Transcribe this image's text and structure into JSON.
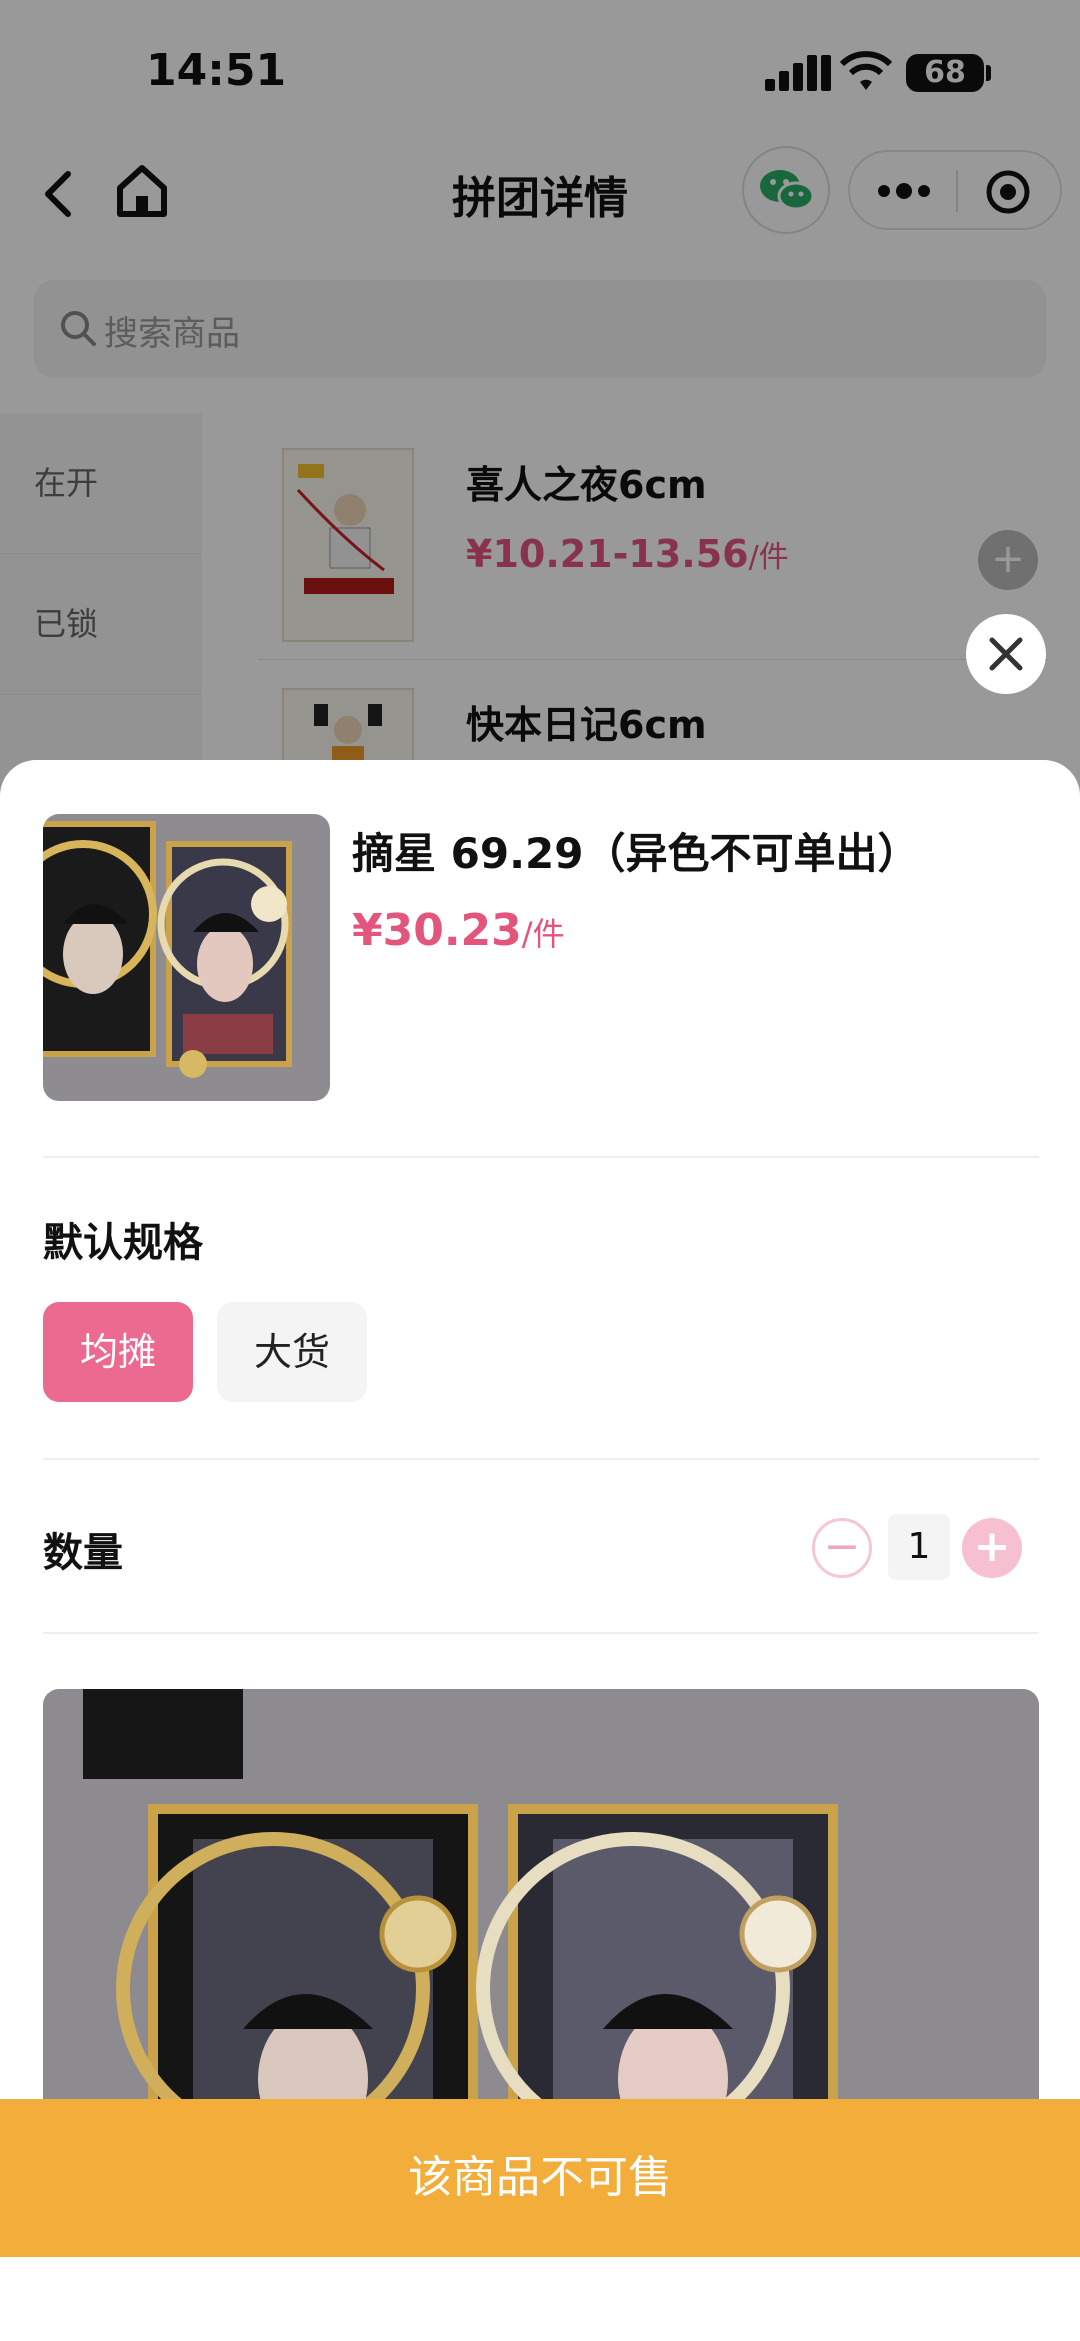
{
  "status_bar": {
    "time": "14:51",
    "battery": "68"
  },
  "nav": {
    "title": "拼团详情"
  },
  "search": {
    "placeholder": "搜索商品"
  },
  "categories": [
    {
      "label": "在开"
    },
    {
      "label": "已锁"
    }
  ],
  "products": [
    {
      "name": "喜人之夜6cm",
      "price": "¥10.21-13.56",
      "unit": "/件"
    },
    {
      "name": "快本日记6cm"
    }
  ],
  "sheet": {
    "title": "摘星 69.29（异色不可单出）",
    "price": "¥30.23",
    "unit": "/件",
    "spec_label": "默认规格",
    "spec_options": [
      {
        "label": "均摊",
        "selected": true
      },
      {
        "label": "大货",
        "selected": false
      }
    ],
    "quantity_label": "数量",
    "quantity_value": "1",
    "buy_button": "该商品不可售"
  },
  "colors": {
    "accent_pink": "#ec6a8f",
    "price_pink": "#e3557d",
    "buy_orange": "#f3ad3b"
  }
}
